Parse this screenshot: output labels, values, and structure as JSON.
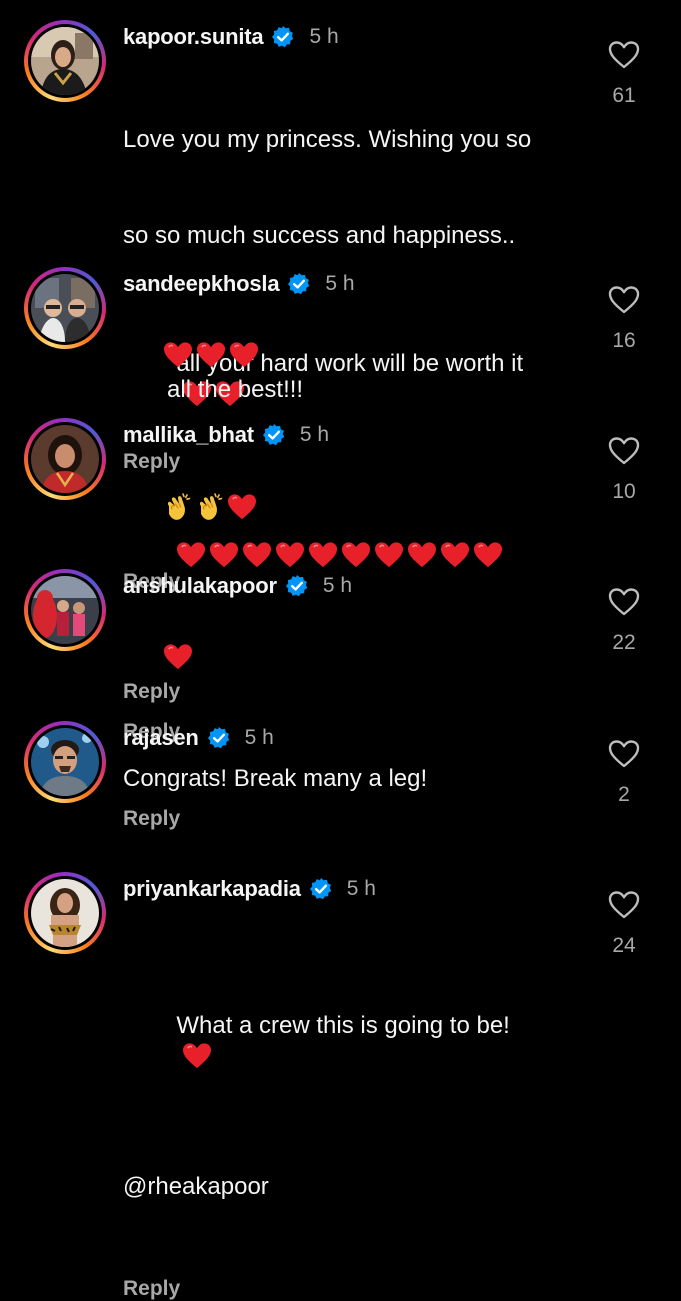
{
  "colors": {
    "background": "#000000",
    "text": "#f5f5f5",
    "secondary": "#a8a8a8",
    "verified": "#0095f6",
    "heart": "#e8202a"
  },
  "comments": [
    {
      "username": "kapoor.sunita",
      "time": "5 h",
      "text_line1": "Love you my princess. Wishing you so",
      "text_line2": "so so much success and happiness..",
      "text_line3": "all your hard work will be worth it",
      "emoji": "❤️❤️❤️❤️❤️❤️❤️❤️❤️❤️❤️❤️",
      "reply": "Reply",
      "likes": "61"
    },
    {
      "username": "sandeepkhosla",
      "time": "5 h",
      "emoji": "❤️❤️❤️",
      "text": "all the best!!!",
      "reply": "Reply",
      "likes": "16"
    },
    {
      "username": "mallika_bhat",
      "time": "5 h",
      "emoji": "👏👏❤️",
      "reply": "Reply",
      "likes": "10"
    },
    {
      "username": "anshulakapoor",
      "time": "5 h",
      "emoji": "❤️",
      "reply": "Reply",
      "likes": "22"
    },
    {
      "username": "rajasen",
      "time": "5 h",
      "text": "Congrats! Break many a leg!",
      "reply": "Reply",
      "likes": "2"
    },
    {
      "username": "priyankarkapadia",
      "time": "5 h",
      "text_line1": "What a crew this is going to be!",
      "emoji": "❤️",
      "text_line2": "@rheakapoor",
      "reply": "Reply",
      "likes": "24"
    }
  ]
}
